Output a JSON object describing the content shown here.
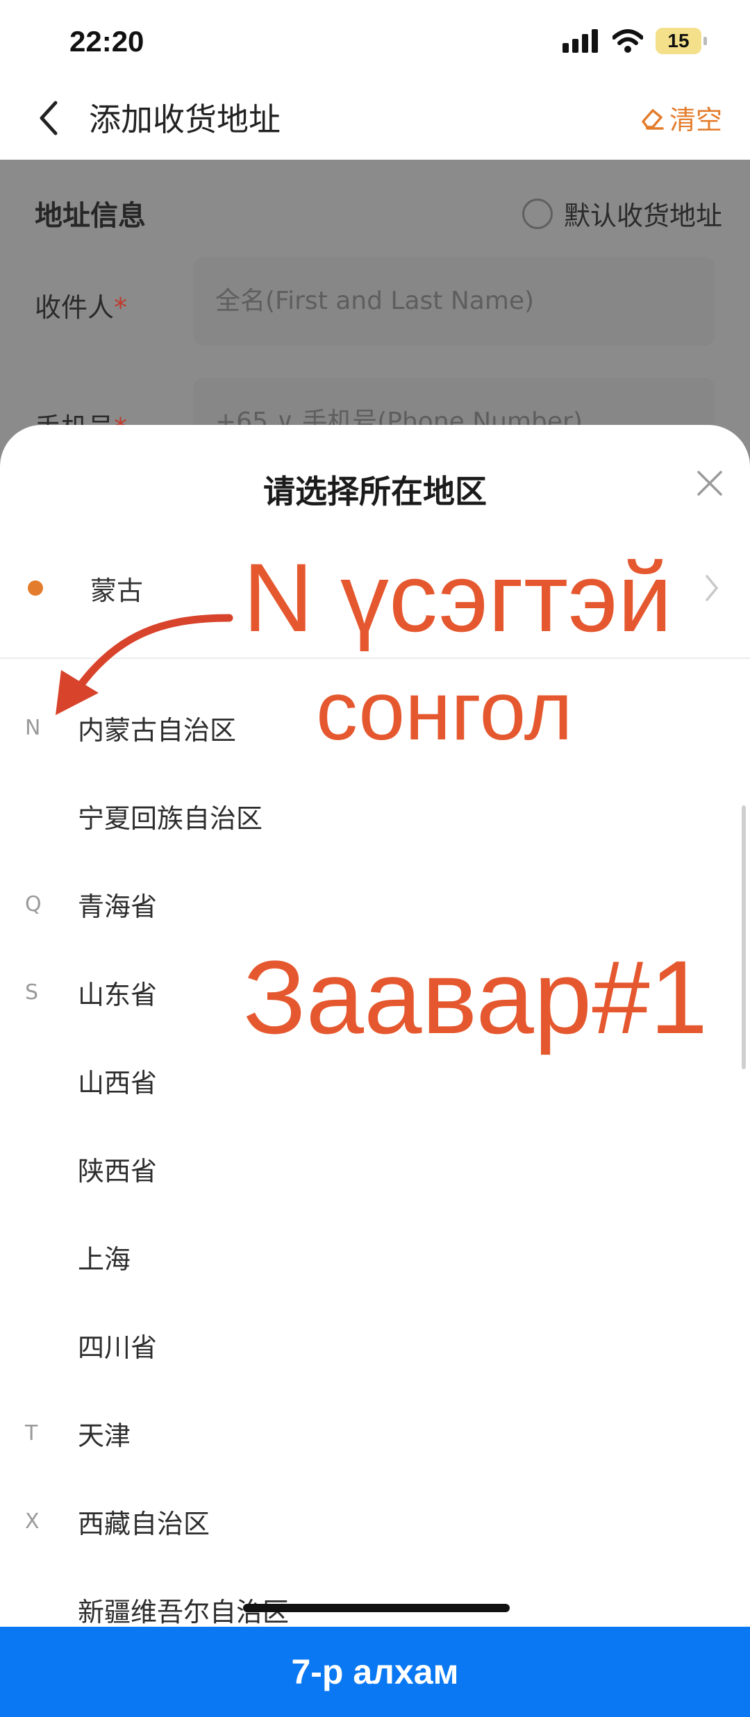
{
  "status_bar": {
    "time": "22:20",
    "battery": "15"
  },
  "header": {
    "title": "添加收货地址",
    "clear_label": "清空"
  },
  "form": {
    "section_title": "地址信息",
    "default_label": "默认收货地址",
    "recipient_label": "收件人",
    "recipient_placeholder": "全名(First and Last Name)",
    "phone_label": "手机号",
    "phone_code": "+65",
    "phone_placeholder": "手机号(Phone Number)",
    "required_mark": "*"
  },
  "sheet": {
    "title": "请选择所在地区",
    "selected": "蒙古",
    "regions": [
      {
        "letter": "N",
        "name": "内蒙古自治区"
      },
      {
        "letter": "",
        "name": "宁夏回族自治区"
      },
      {
        "letter": "Q",
        "name": "青海省"
      },
      {
        "letter": "S",
        "name": "山东省"
      },
      {
        "letter": "",
        "name": "山西省"
      },
      {
        "letter": "",
        "name": "陕西省"
      },
      {
        "letter": "",
        "name": "上海"
      },
      {
        "letter": "",
        "name": "四川省"
      },
      {
        "letter": "T",
        "name": "天津"
      },
      {
        "letter": "X",
        "name": "西藏自治区"
      },
      {
        "letter": "",
        "name": "新疆维吾尔自治区"
      }
    ]
  },
  "annotations": {
    "line1": "N үсэгтэй",
    "line2": "сонгол",
    "line3": "Заавар#1"
  },
  "footer": {
    "label": "7-р алхам"
  },
  "colors": {
    "accent": "#e37c2c",
    "annotation": "#e5582f",
    "footer_bg": "#0a78f2"
  }
}
